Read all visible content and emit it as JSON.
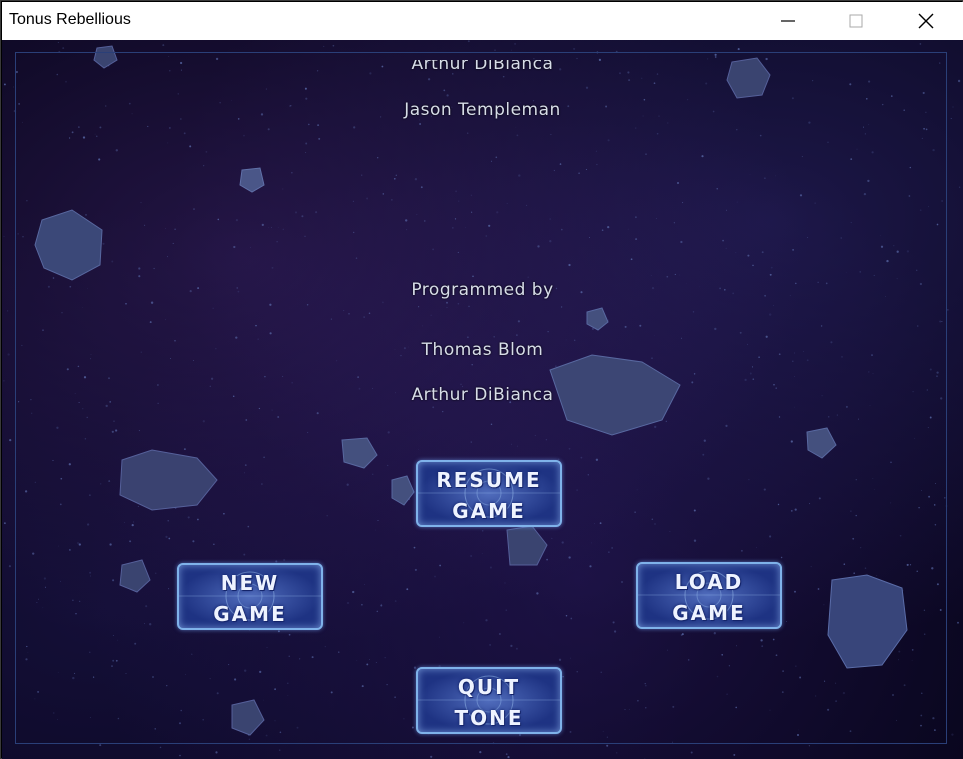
{
  "window": {
    "title": "Tonus Rebellious"
  },
  "credits": {
    "partial_line": "Arthur DiBianca",
    "line1": "Jason Templeman",
    "heading": "Programmed by",
    "name1": "Thomas Blom",
    "name2": "Arthur DiBianca"
  },
  "menu": {
    "resume": {
      "line1": "RESUME",
      "line2": "GAME"
    },
    "new_game": {
      "line1": "NEW",
      "line2": "GAME"
    },
    "load_game": {
      "line1": "LOAD",
      "line2": "GAME"
    },
    "quit": {
      "line1": "QUIT",
      "line2": "TONE"
    }
  },
  "colors": {
    "button_border": "#7fb2ea",
    "button_fill": "#203a8a",
    "text": "#d7dde8",
    "space": "#07051a"
  }
}
